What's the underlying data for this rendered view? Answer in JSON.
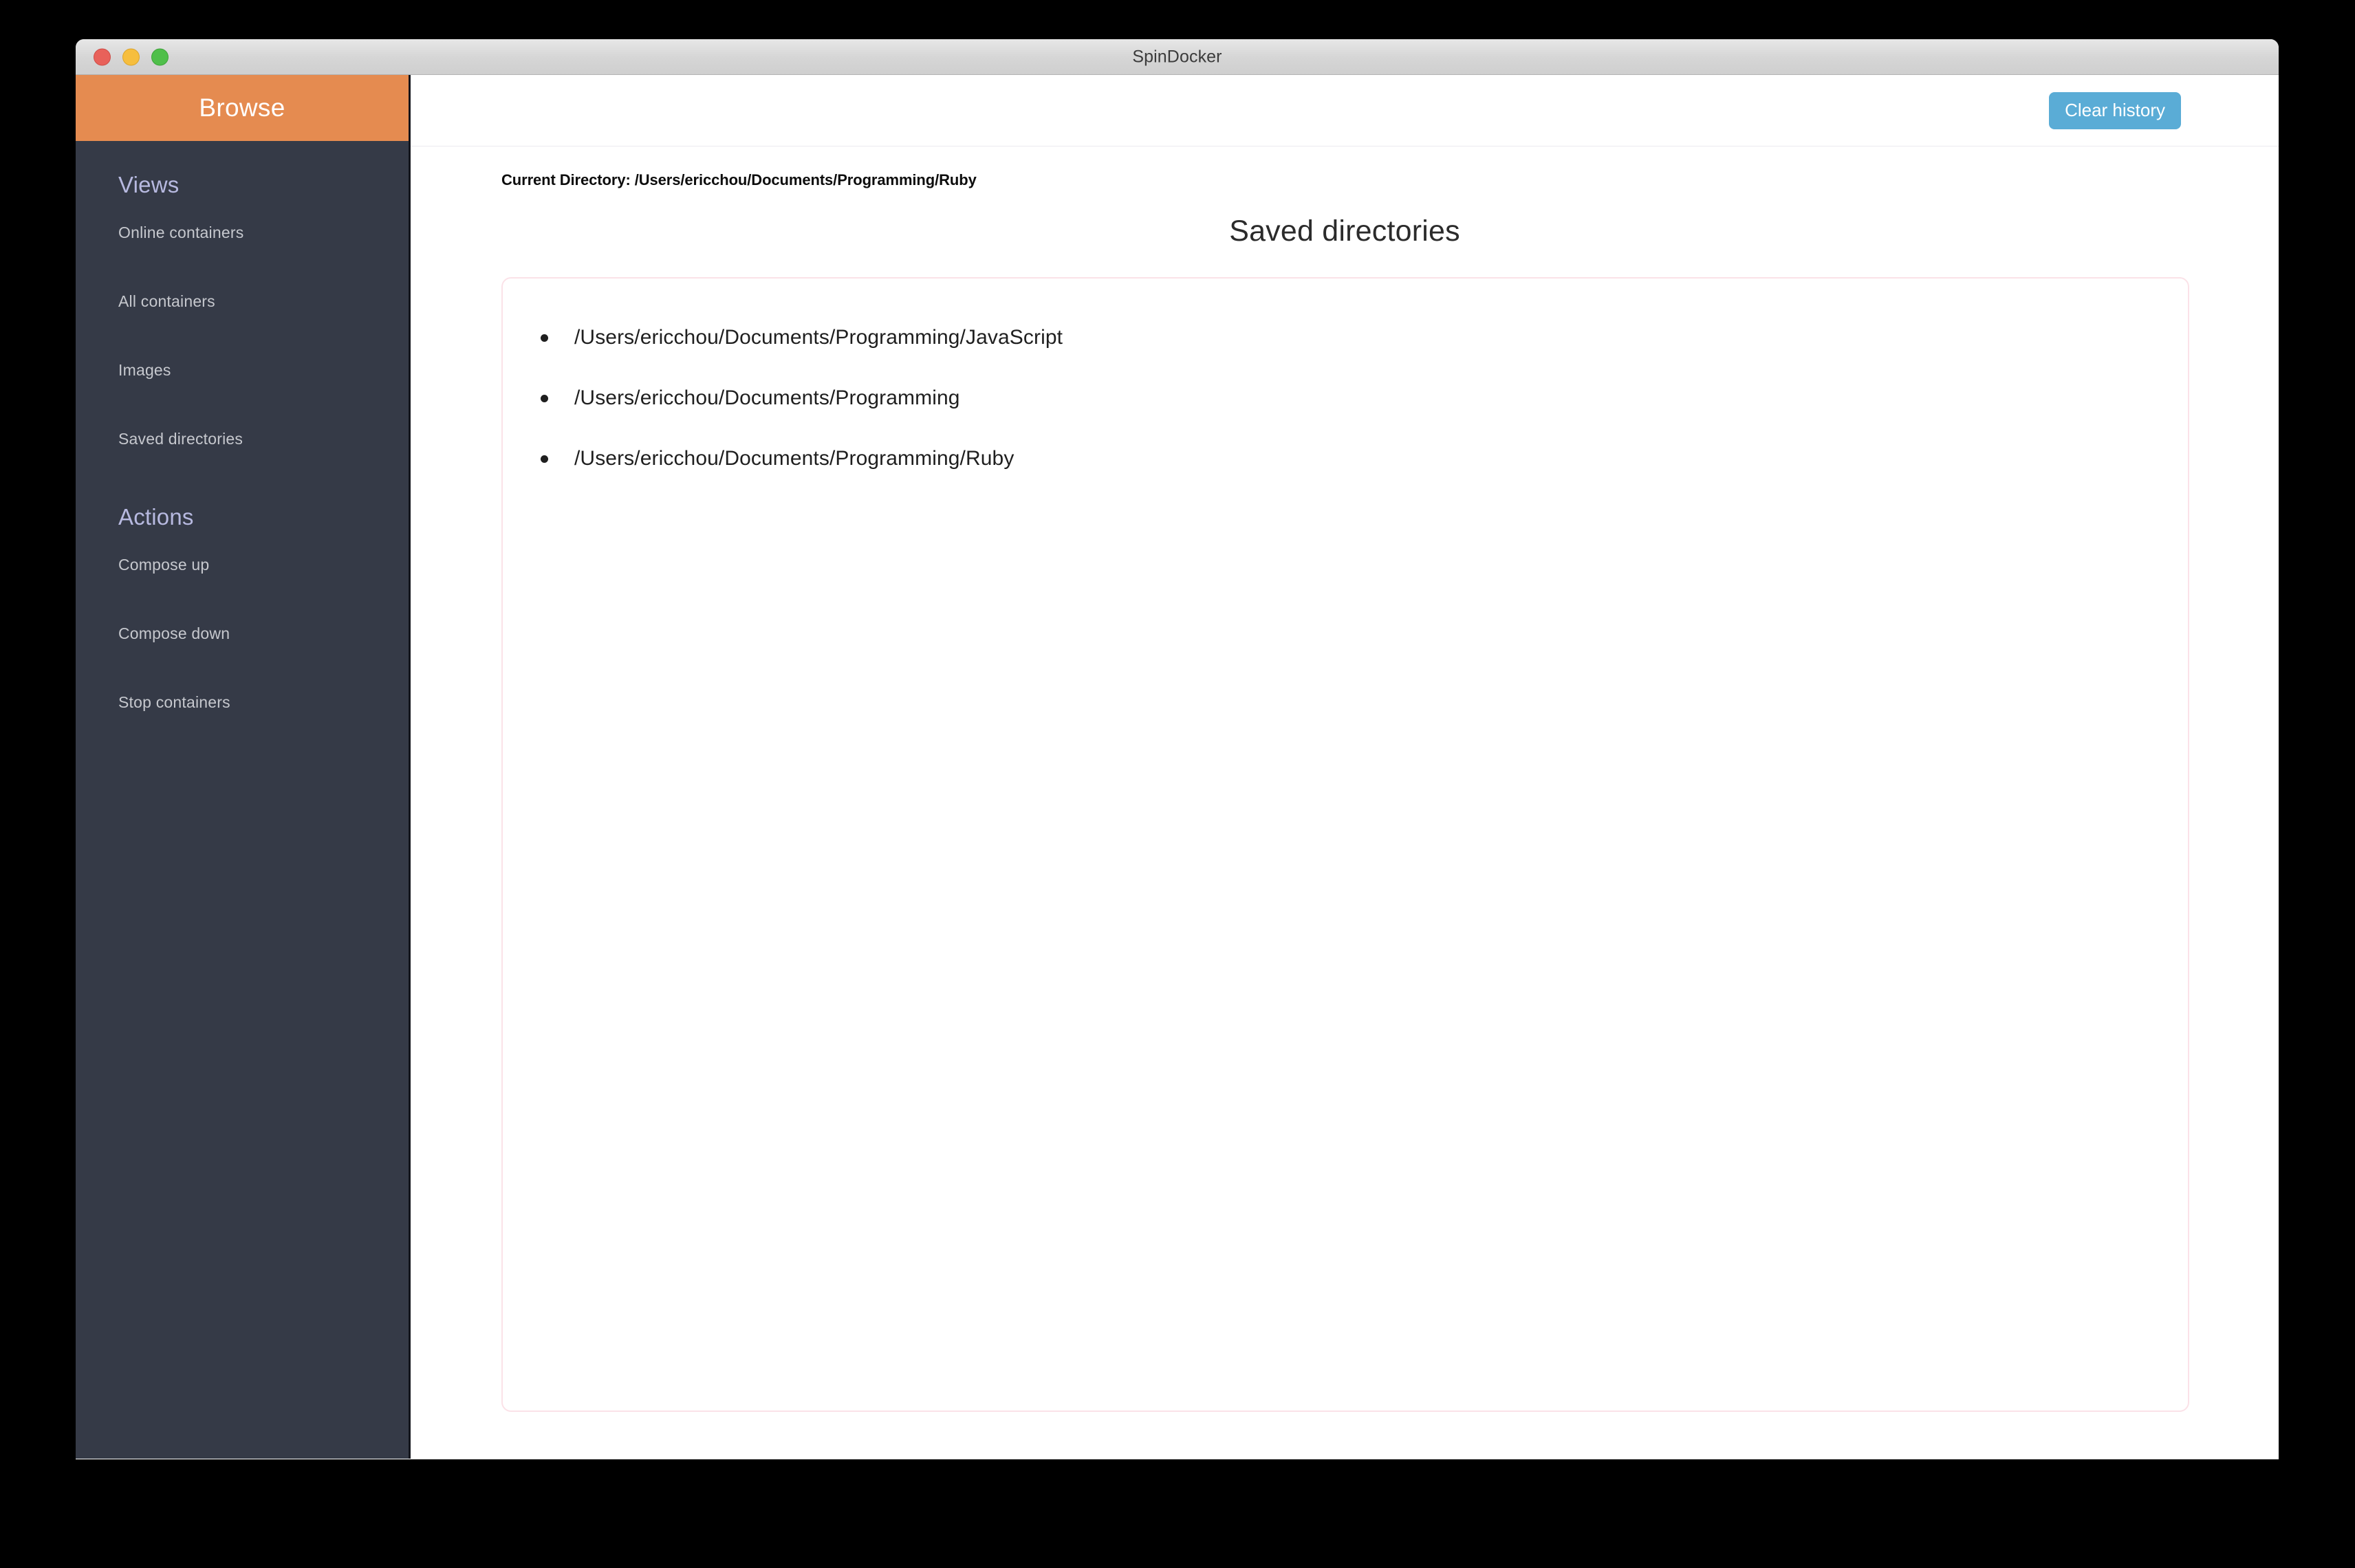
{
  "window": {
    "title": "SpinDocker",
    "traffic_lights": [
      {
        "name": "close-button",
        "color": "#e8615a"
      },
      {
        "name": "minimize-button",
        "color": "#f6be3e"
      },
      {
        "name": "zoom-button",
        "color": "#4fbf4a"
      }
    ]
  },
  "sidebar": {
    "brand_label": "Browse",
    "brand_color": "#e58b50",
    "background_color": "#353a47",
    "sections": [
      {
        "title": "Views",
        "items": [
          {
            "label": "Online containers"
          },
          {
            "label": "All containers"
          },
          {
            "label": "Images"
          },
          {
            "label": "Saved directories"
          }
        ]
      },
      {
        "title": "Actions",
        "items": [
          {
            "label": "Compose up"
          },
          {
            "label": "Compose down"
          },
          {
            "label": "Stop containers"
          }
        ]
      }
    ]
  },
  "toolbar": {
    "clear_history_label": "Clear history",
    "clear_history_color": "#5aacd6"
  },
  "main": {
    "current_directory_text": "Current Directory: /Users/ericchou/Documents/Programming/Ruby",
    "heading": "Saved directories",
    "saved_directories": [
      "/Users/ericchou/Documents/Programming/JavaScript",
      "/Users/ericchou/Documents/Programming",
      "/Users/ericchou/Documents/Programming/Ruby"
    ],
    "panel_border_color": "#fbe2e8"
  }
}
